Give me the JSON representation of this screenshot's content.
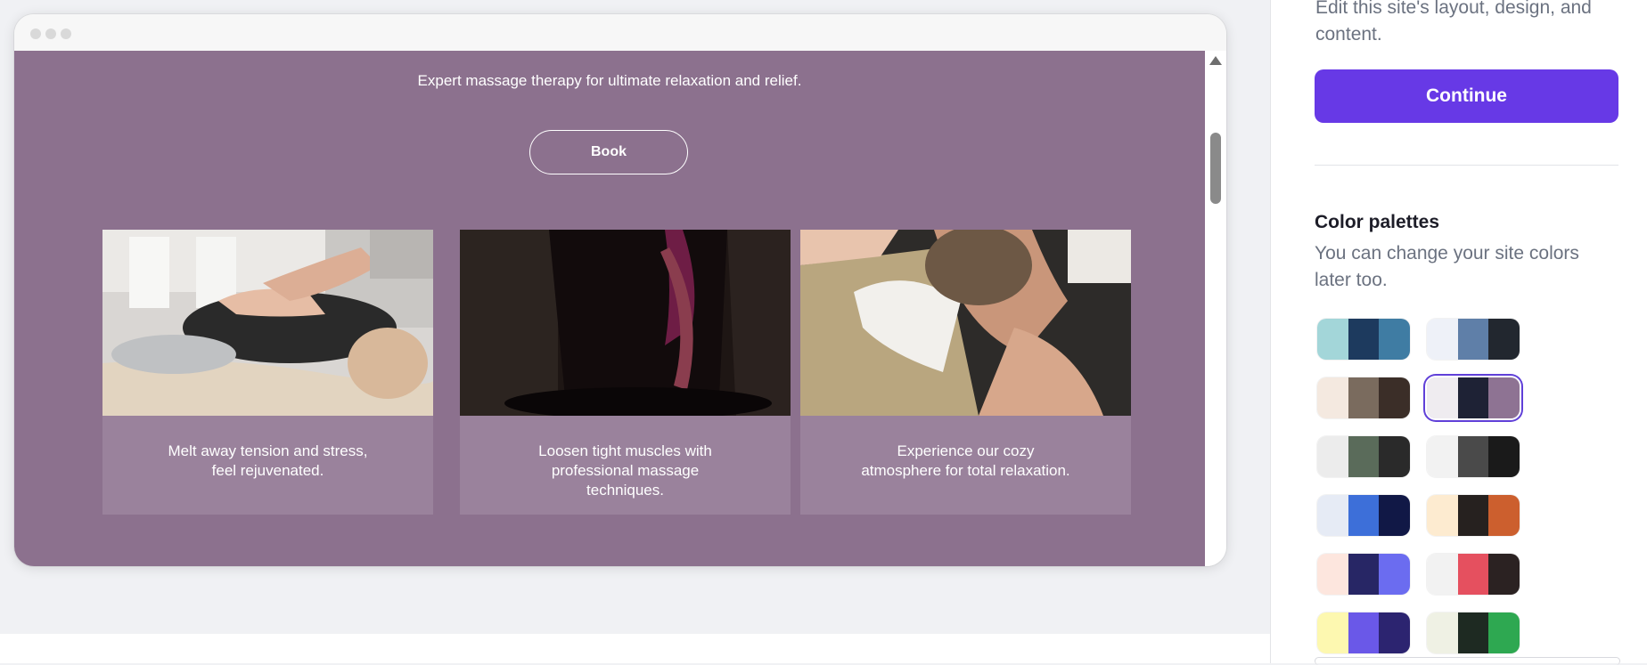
{
  "preview": {
    "subtitle": "Expert massage therapy for ultimate relaxation and relief.",
    "book_label": "Book",
    "cards": [
      {
        "caption_line1": "Melt away tension and stress,",
        "caption_line2": "feel rejuvenated.",
        "caption_line3": "",
        "image": "child-back-massage-photo"
      },
      {
        "caption_line1": "Loosen tight muscles with",
        "caption_line2": "professional massage",
        "caption_line3": "techniques.",
        "image": "dark-massage-photo"
      },
      {
        "caption_line1": "Experience our cozy",
        "caption_line2": "atmosphere for total relaxation.",
        "caption_line3": "",
        "image": "neck-massage-photo"
      }
    ],
    "background_color": "#8c718e"
  },
  "panel": {
    "description": "Edit this site's layout, design, and content.",
    "continue_label": "Continue",
    "palettes_title": "Color palettes",
    "palettes_subtitle": "You can change your site colors later too.",
    "accent_color": "#6739e6",
    "palettes": [
      [
        "#a3d6d9",
        "#1d3a5e",
        "#3f7ca3"
      ],
      [
        "#eef1f8",
        "#5f7fa8",
        "#22272f"
      ],
      [
        "#f4e9e0",
        "#7a6b5e",
        "#3b2e28"
      ],
      [
        "#efecf0",
        "#1e2235",
        "#8e7393"
      ],
      [
        "#ececec",
        "#5a6b5a",
        "#2a2a2a"
      ],
      [
        "#f2f2f2",
        "#4a4a4a",
        "#1a1a1a"
      ],
      [
        "#e6ebf5",
        "#3d6fd9",
        "#111846"
      ],
      [
        "#fdebd0",
        "#26211f",
        "#cc5f2e"
      ],
      [
        "#fde6de",
        "#272665",
        "#6b6cf0"
      ],
      [
        "#f2f2f2",
        "#e5505f",
        "#2b2222"
      ],
      [
        "#fdf8b0",
        "#6a58e8",
        "#2c2470"
      ],
      [
        "#eff1e4",
        "#1e2a22",
        "#2ea851"
      ]
    ],
    "selected_palette": 3
  }
}
